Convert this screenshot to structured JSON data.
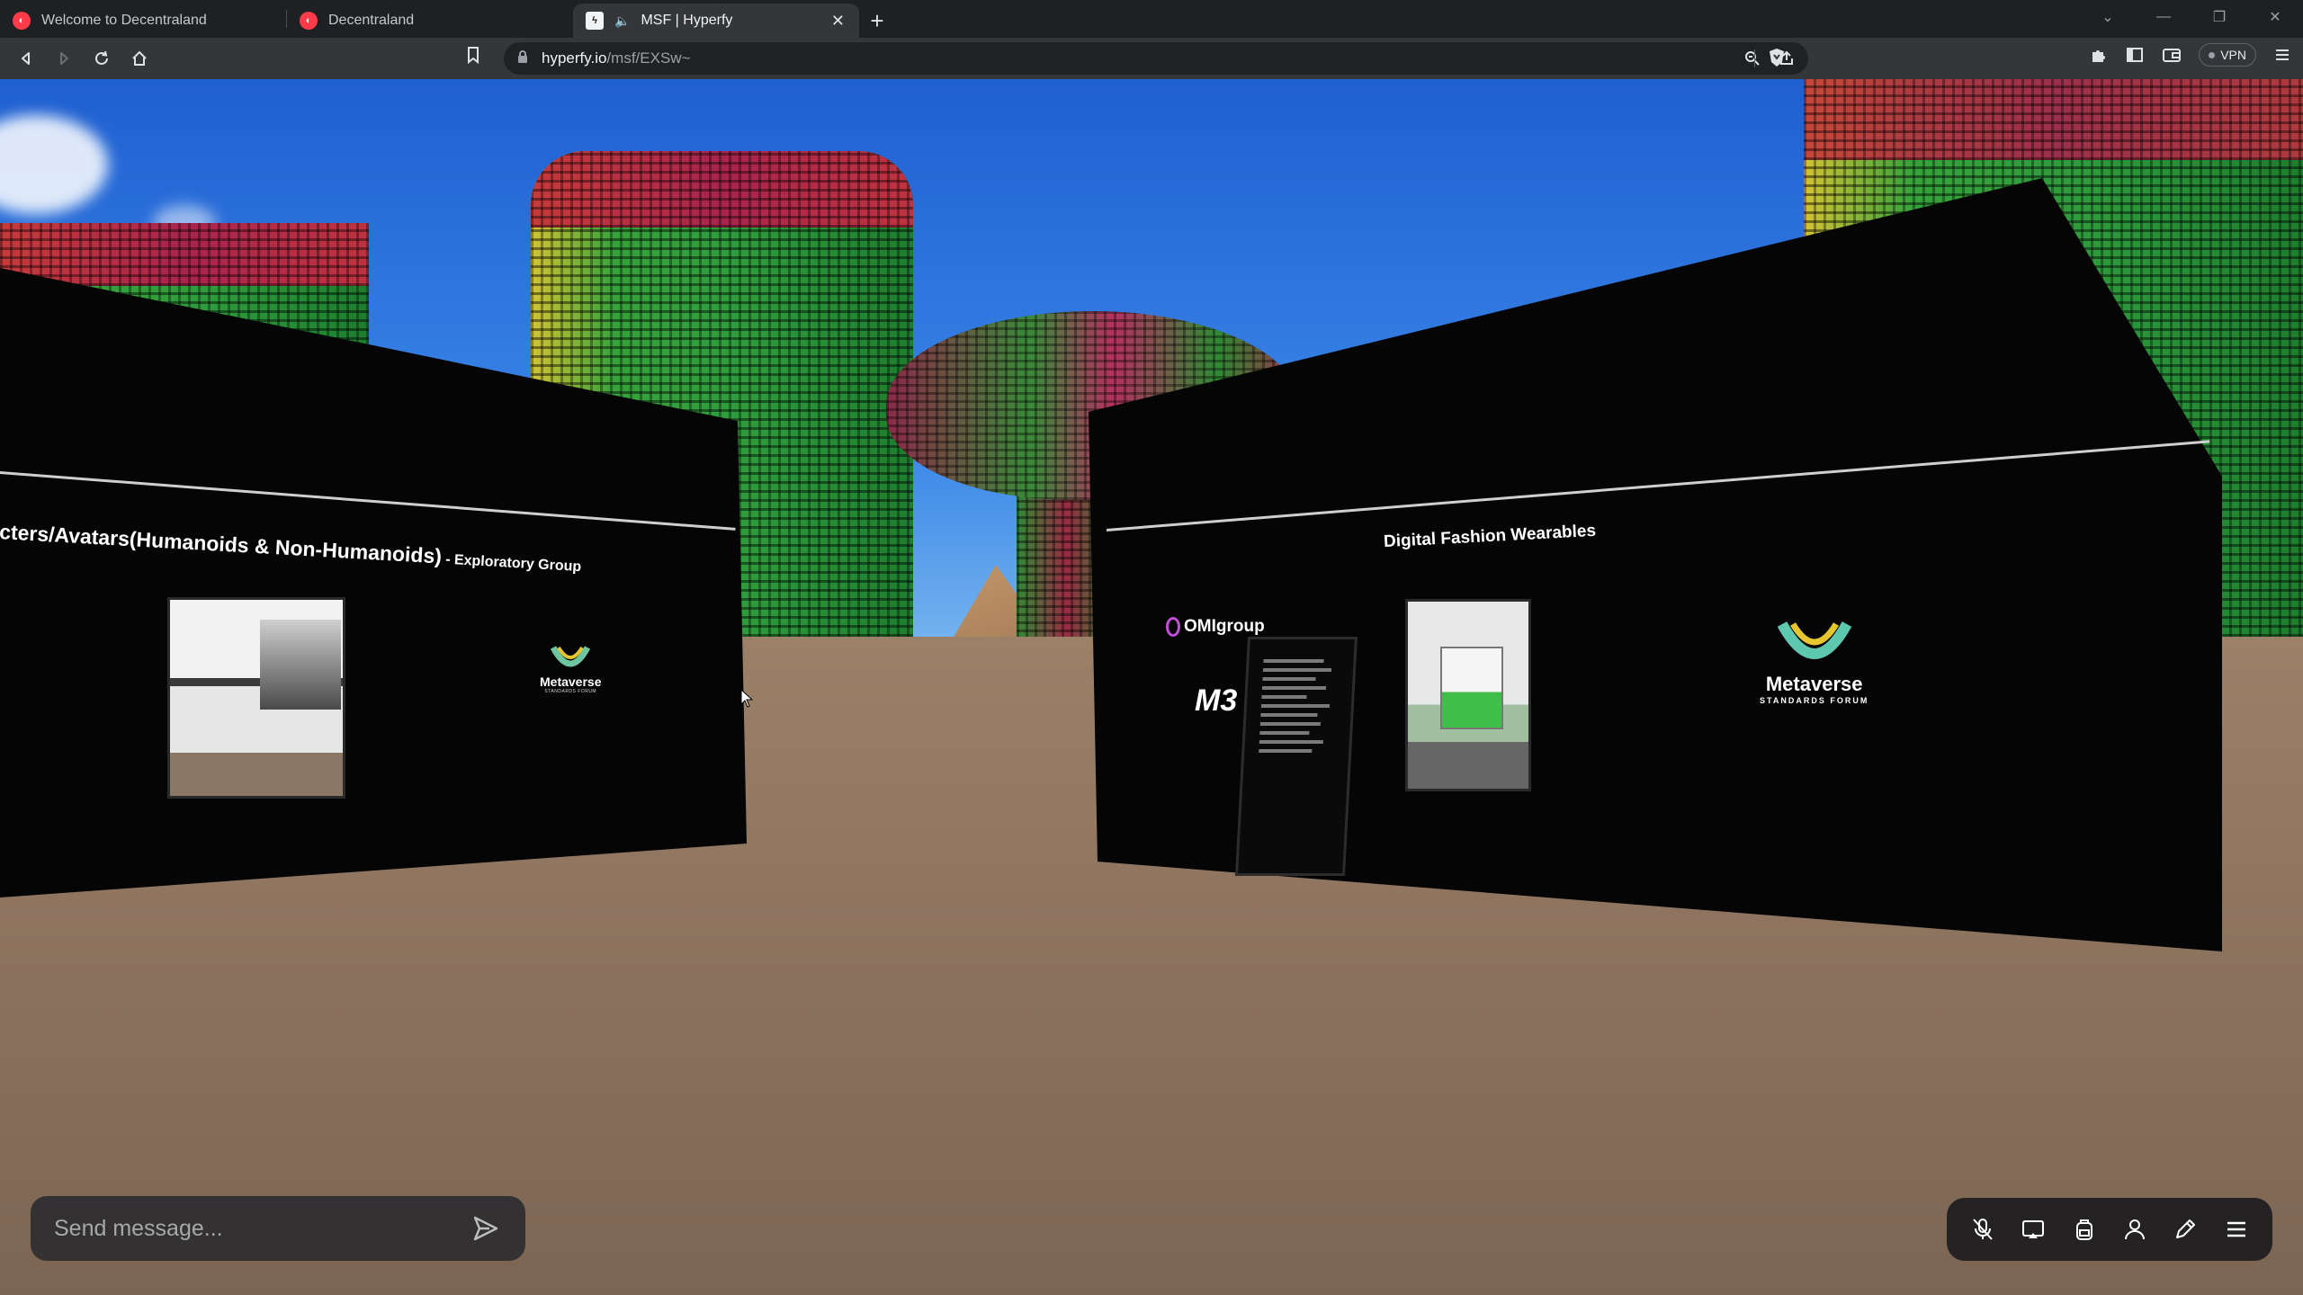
{
  "browser": {
    "tabs": [
      {
        "label": "Welcome to Decentraland",
        "icon": "decentraland-icon"
      },
      {
        "label": "Decentraland",
        "icon": "decentraland-icon"
      },
      {
        "label": "MSF | Hyperfy",
        "icon": "hyperfy-icon",
        "active": true
      }
    ],
    "url_host": "hyperfy.io",
    "url_path": "/msf/EXSw~",
    "vpn_label": "VPN"
  },
  "scene": {
    "left_wall_text": "cters/Avatars(Humanoids & Non-Humanoids)",
    "left_wall_subtext": " - Exploratory Group",
    "right_wall_text": "Digital Fashion Wearables",
    "logo_name": "Metaverse",
    "logo_sub": "STANDARDS FORUM",
    "omi_label": "OMIgroup",
    "m3_label": "M3"
  },
  "chat": {
    "placeholder": "Send message..."
  },
  "controls": [
    "mic-off-icon",
    "screen-share-icon",
    "backpack-icon",
    "avatar-icon",
    "build-pencil-icon",
    "menu-icon"
  ],
  "colors": {
    "accent_green": "#2e9c3c",
    "accent_red": "#c63a3a",
    "panel_bg": "#1c1c1e"
  }
}
